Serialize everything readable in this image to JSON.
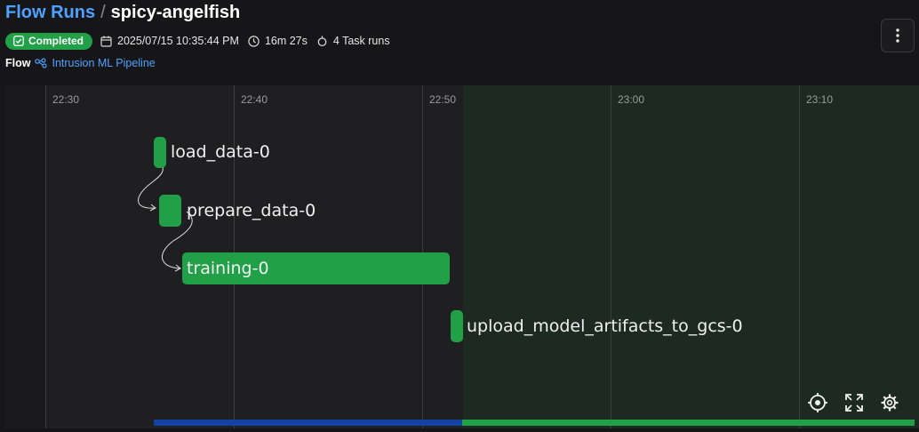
{
  "breadcrumb": {
    "parent": "Flow Runs",
    "separator": "/",
    "current": "spicy-angelfish"
  },
  "run": {
    "status": "Completed",
    "start_time": "2025/07/15 10:35:44 PM",
    "duration": "16m 27s",
    "task_runs": "4 Task runs"
  },
  "flow": {
    "label": "Flow",
    "name": "Intrusion ML Pipeline"
  },
  "timeline": {
    "ticks": [
      "22:30",
      "22:40",
      "22:50",
      "23:00",
      "23:10"
    ],
    "tasks": [
      {
        "name": "load_data-0"
      },
      {
        "name": "prepare_data-0"
      },
      {
        "name": "training-0"
      },
      {
        "name": "upload_model_artifacts_to_gcs-0"
      }
    ]
  },
  "colors": {
    "accent": "#4ea1ff",
    "success": "#22a048",
    "progress": "#1243a0"
  },
  "icons": [
    "calendar-icon",
    "clock-icon",
    "task-run-icon",
    "flow-icon",
    "more-vertical-icon",
    "recenter-icon",
    "fullscreen-icon",
    "settings-icon"
  ]
}
